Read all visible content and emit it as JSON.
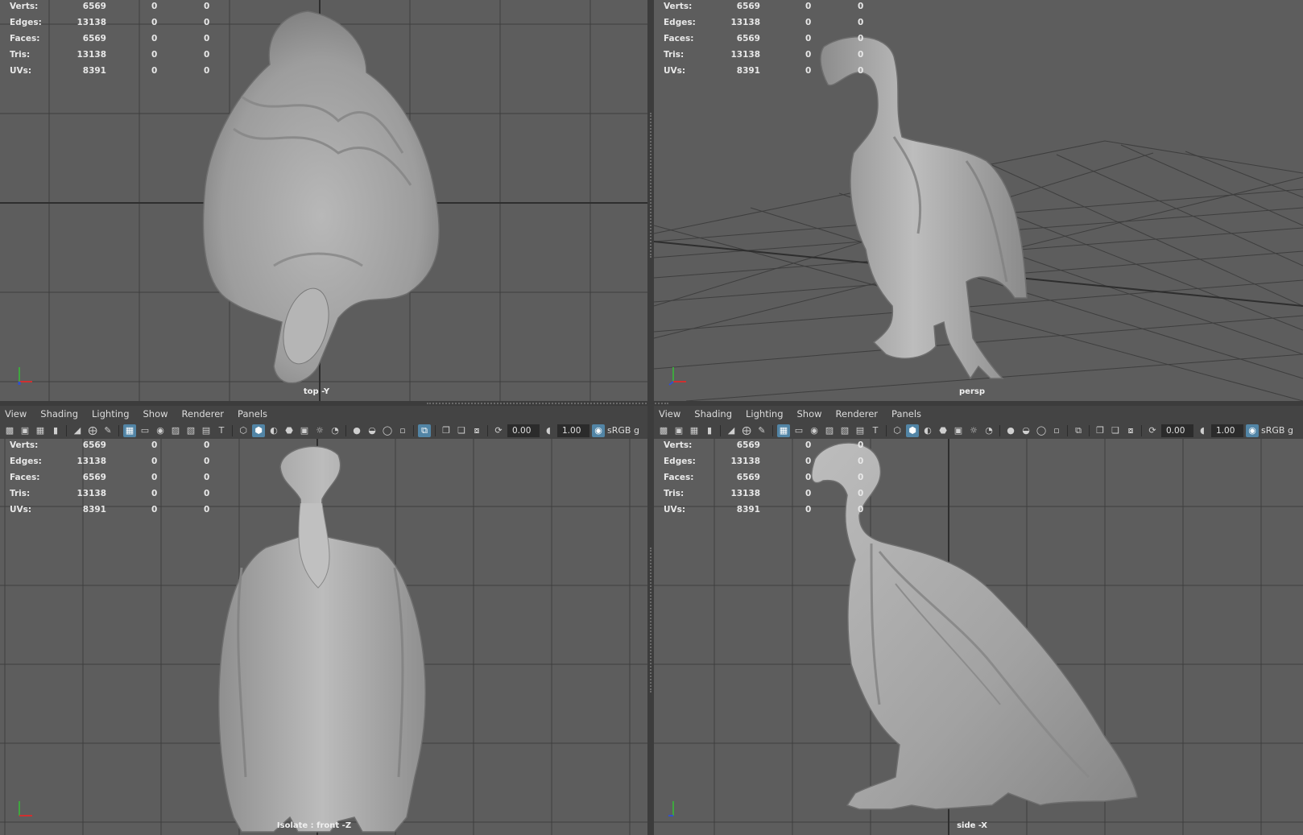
{
  "stats_rows": [
    {
      "label": "Verts:",
      "value": "6569",
      "z1": "0",
      "z2": "0"
    },
    {
      "label": "Edges:",
      "value": "13138",
      "z1": "0",
      "z2": "0"
    },
    {
      "label": "Faces:",
      "value": "6569",
      "z1": "0",
      "z2": "0"
    },
    {
      "label": "Tris:",
      "value": "13138",
      "z1": "0",
      "z2": "0"
    },
    {
      "label": "UVs:",
      "value": "8391",
      "z1": "0",
      "z2": "0"
    }
  ],
  "viewports": {
    "top": {
      "camera": "top -Y"
    },
    "persp": {
      "camera": "persp"
    },
    "front": {
      "camera": "Isolate : front -Z"
    },
    "side": {
      "camera": "side -X"
    }
  },
  "panel_menu": {
    "view": "View",
    "shading": "Shading",
    "lighting": "Lighting",
    "show": "Show",
    "renderer": "Renderer",
    "panels": "Panels"
  },
  "toolbar": {
    "exposure_value": "0.00",
    "gamma_value": "1.00",
    "color_space": "sRGB g"
  },
  "colors": {
    "viewport_bg": "#5d5d5d",
    "grid_line": "#3e3e3e",
    "panel_bg": "#444444",
    "active_button": "#5285a6",
    "model_fill": "#a9a9a9"
  },
  "icons": [
    "camera-icon",
    "grid-icon",
    "wireframe-icon",
    "smooth-shade-icon",
    "lights-icon",
    "isolate-icon",
    "exposure-icon",
    "gamma-icon",
    "color-management-icon"
  ]
}
